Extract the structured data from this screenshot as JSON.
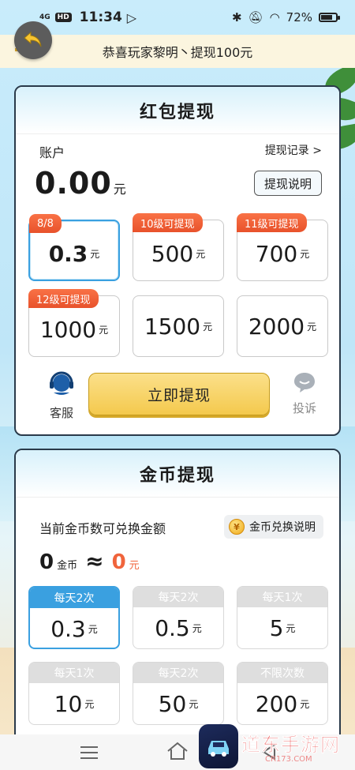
{
  "statusbar": {
    "network": "4G",
    "hd": "HD",
    "time": "11:34",
    "battery": "72%"
  },
  "banner": {
    "text": "恭喜玩家黎明丶提现100元"
  },
  "redpacket": {
    "title": "红包提现",
    "account_label": "账户",
    "record_link": "提现记录 >",
    "balance": "0.00",
    "balance_unit": "元",
    "explain_button": "提现说明",
    "tiles": [
      {
        "tag": "8/8",
        "amount": "0.3",
        "unit": "元",
        "selected": true
      },
      {
        "tag": "10级可提现",
        "amount": "500",
        "unit": "元",
        "selected": false
      },
      {
        "tag": "11级可提现",
        "amount": "700",
        "unit": "元",
        "selected": false
      },
      {
        "tag": "12级可提现",
        "amount": "1000",
        "unit": "元",
        "selected": false
      },
      {
        "tag": "",
        "amount": "1500",
        "unit": "元",
        "selected": false
      },
      {
        "tag": "",
        "amount": "2000",
        "unit": "元",
        "selected": false
      }
    ],
    "customer_service_label": "客服",
    "withdraw_button": "立即提现",
    "complaint_label": "投诉"
  },
  "coin": {
    "title": "金币提现",
    "exchange_label": "当前金币数可兑换金额",
    "explain_button": "金币兑换说明",
    "coins": "0",
    "coins_unit": "金币",
    "approx": "≈",
    "money": "0",
    "money_unit": "元",
    "tiles": [
      {
        "head": "每天2次",
        "amount": "0.3",
        "unit": "元",
        "selected": true
      },
      {
        "head": "每天2次",
        "amount": "0.5",
        "unit": "元",
        "selected": false
      },
      {
        "head": "每天1次",
        "amount": "5",
        "unit": "元",
        "selected": false
      },
      {
        "head": "每天1次",
        "amount": "10",
        "unit": "元",
        "selected": false
      },
      {
        "head": "每天2次",
        "amount": "50",
        "unit": "元",
        "selected": false
      },
      {
        "head": "不限次数",
        "amount": "200",
        "unit": "元",
        "selected": false
      }
    ]
  },
  "watermark": {
    "title": "道东手游网",
    "subtitle": "CR173.COM"
  },
  "colors": {
    "accent_blue": "#3aa0e0",
    "tag_red": "#e8522b",
    "button_yellow": "#f4c94d",
    "money_orange": "#f0643c"
  }
}
